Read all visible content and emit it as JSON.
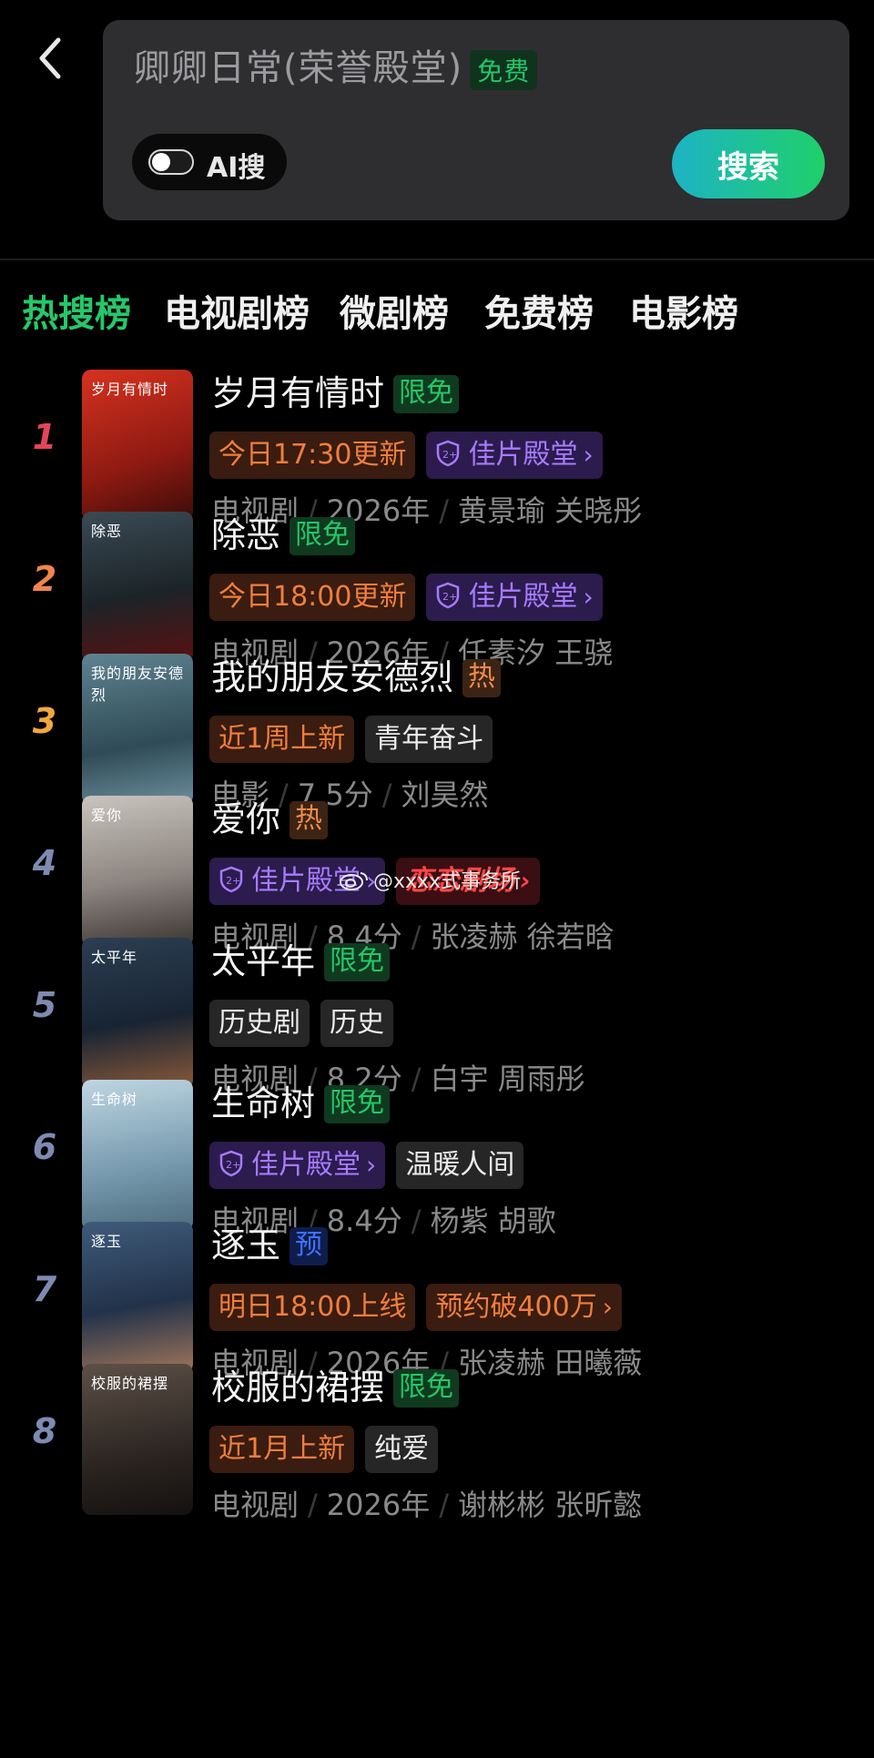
{
  "search": {
    "query": "卿卿日常(荣誉殿堂)",
    "query_tag": "免费",
    "ai_toggle_label": "AI搜",
    "ai_toggle_on": false,
    "button_label": "搜索"
  },
  "tabs": [
    {
      "label": "热搜榜",
      "active": true
    },
    {
      "label": "电视剧榜",
      "active": false
    },
    {
      "label": "微剧榜",
      "active": false
    },
    {
      "label": "免费榜",
      "active": false
    },
    {
      "label": "电影榜",
      "active": false
    }
  ],
  "items": [
    {
      "rank": "1",
      "rank_color": "#e5445a",
      "title": "岁月有情时",
      "badge": "限免",
      "badge_type": "free",
      "poster_title": "岁月有情时",
      "tags": [
        {
          "text": "今日17:30更新",
          "type": "orange"
        },
        {
          "text": "佳片殿堂",
          "type": "purple"
        }
      ],
      "meta": [
        "电视剧",
        "2026年",
        "黄景瑜 关晓彤"
      ]
    },
    {
      "rank": "2",
      "rank_color": "#f0844e",
      "title": "除恶",
      "badge": "限免",
      "badge_type": "free",
      "poster_title": "除恶",
      "tags": [
        {
          "text": "今日18:00更新",
          "type": "orange"
        },
        {
          "text": "佳片殿堂",
          "type": "purple"
        }
      ],
      "meta": [
        "电视剧",
        "2026年",
        "任素汐 王骁"
      ]
    },
    {
      "rank": "3",
      "rank_color": "#f0a83e",
      "title": "我的朋友安德烈",
      "badge": "热",
      "badge_type": "hot",
      "poster_title": "我的朋友安德烈",
      "tags": [
        {
          "text": "近1周上新",
          "type": "orange"
        },
        {
          "text": "青年奋斗",
          "type": "gray"
        }
      ],
      "meta": [
        "电影",
        "7.5分",
        "刘昊然"
      ]
    },
    {
      "rank": "4",
      "rank_color": "#7d8bb2",
      "title": "爱你",
      "badge": "热",
      "badge_type": "hot",
      "poster_title": "爱你",
      "tags": [
        {
          "text": "佳片殿堂",
          "type": "purple"
        },
        {
          "text": "恋恋剧场",
          "type": "red"
        }
      ],
      "meta": [
        "电视剧",
        "8.4分",
        "张凌赫 徐若晗"
      ]
    },
    {
      "rank": "5",
      "rank_color": "#7d8bb2",
      "title": "太平年",
      "badge": "限免",
      "badge_type": "free",
      "poster_title": "太平年",
      "tags": [
        {
          "text": "历史剧",
          "type": "gray"
        },
        {
          "text": "历史",
          "type": "gray"
        }
      ],
      "meta": [
        "电视剧",
        "8.2分",
        "白宇 周雨彤"
      ]
    },
    {
      "rank": "6",
      "rank_color": "#7d8bb2",
      "title": "生命树",
      "badge": "限免",
      "badge_type": "free",
      "poster_title": "生命树",
      "tags": [
        {
          "text": "佳片殿堂",
          "type": "purple"
        },
        {
          "text": "温暖人间",
          "type": "gray"
        }
      ],
      "meta": [
        "电视剧",
        "8.4分",
        "杨紫 胡歌"
      ]
    },
    {
      "rank": "7",
      "rank_color": "#7d8bb2",
      "title": "逐玉",
      "badge": "预",
      "badge_type": "pre",
      "poster_title": "逐玉",
      "tags": [
        {
          "text": "明日18:00上线",
          "type": "orange"
        },
        {
          "text": "预约破400万",
          "type": "orange"
        }
      ],
      "meta": [
        "电视剧",
        "2026年",
        "张凌赫 田曦薇"
      ]
    },
    {
      "rank": "8",
      "rank_color": "#7d8bb2",
      "title": "校服的裙摆",
      "badge": "限免",
      "badge_type": "free",
      "poster_title": "校服的裙摆",
      "tags": [
        {
          "text": "近1月上新",
          "type": "orange"
        },
        {
          "text": "纯爱",
          "type": "gray"
        }
      ],
      "meta": [
        "电视剧",
        "2026年",
        "谢彬彬 张昕懿"
      ]
    }
  ],
  "watermark": "@xxxx式事务所",
  "colors": {
    "accent_green": "#26c76a",
    "background": "#000000"
  }
}
